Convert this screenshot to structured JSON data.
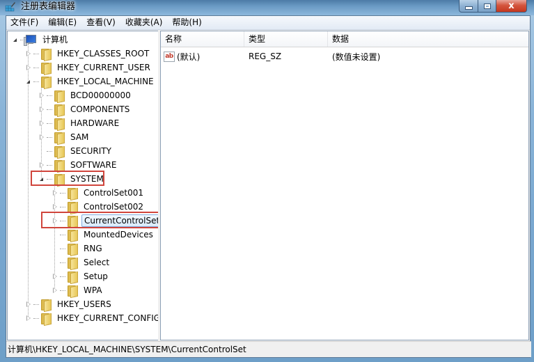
{
  "window": {
    "title": "注册表编辑器",
    "close_glyph": "x"
  },
  "menu": [
    {
      "label": "文件(F)"
    },
    {
      "label": "编辑(E)"
    },
    {
      "label": "查看(V)"
    },
    {
      "label": "收藏夹(A)"
    },
    {
      "label": "帮助(H)"
    }
  ],
  "tree": {
    "root": "计算机",
    "nodes": [
      {
        "label": "HKEY_CLASSES_ROOT",
        "state": "collapsed"
      },
      {
        "label": "HKEY_CURRENT_USER",
        "state": "collapsed"
      },
      {
        "label": "HKEY_LOCAL_MACHINE",
        "state": "expanded"
      },
      {
        "label": "BCD00000000",
        "state": "collapsed"
      },
      {
        "label": "COMPONENTS",
        "state": "collapsed"
      },
      {
        "label": "HARDWARE",
        "state": "collapsed"
      },
      {
        "label": "SAM",
        "state": "collapsed"
      },
      {
        "label": "SECURITY",
        "state": "leaf"
      },
      {
        "label": "SOFTWARE",
        "state": "collapsed"
      },
      {
        "label": "SYSTEM",
        "state": "expanded",
        "highlighted": true
      },
      {
        "label": "ControlSet001",
        "state": "collapsed"
      },
      {
        "label": "ControlSet002",
        "state": "collapsed"
      },
      {
        "label": "CurrentControlSet",
        "state": "collapsed",
        "selected": true,
        "highlighted": true
      },
      {
        "label": "MountedDevices",
        "state": "leaf"
      },
      {
        "label": "RNG",
        "state": "leaf"
      },
      {
        "label": "Select",
        "state": "leaf"
      },
      {
        "label": "Setup",
        "state": "collapsed"
      },
      {
        "label": "WPA",
        "state": "collapsed"
      },
      {
        "label": "HKEY_USERS",
        "state": "collapsed"
      },
      {
        "label": "HKEY_CURRENT_CONFIG",
        "state": "collapsed"
      }
    ]
  },
  "list": {
    "columns": {
      "name": "名称",
      "type": "类型",
      "data": "数据"
    },
    "rows": [
      {
        "icon": "ab",
        "name": "(默认)",
        "type": "REG_SZ",
        "data": "(数值未设置)"
      }
    ]
  },
  "status": {
    "path": "计算机\\HKEY_LOCAL_MACHINE\\SYSTEM\\CurrentControlSet"
  },
  "colors": {
    "highlight_box": "#d0453c",
    "selection_border": "#84acdd"
  }
}
